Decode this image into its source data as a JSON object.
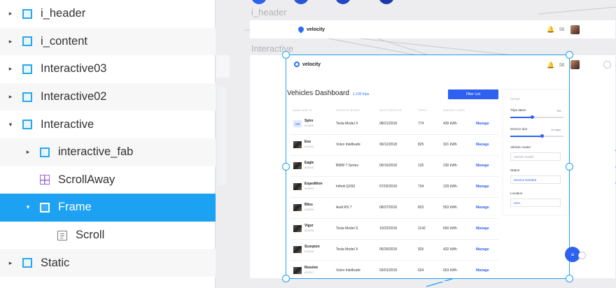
{
  "layers": [
    {
      "label": "i_header",
      "disclosure": "▸",
      "icon": "frame-icon",
      "indent": 0
    },
    {
      "label": "i_content",
      "disclosure": "▸",
      "icon": "frame-icon",
      "indent": 0
    },
    {
      "label": "Interactive03",
      "disclosure": "▸",
      "icon": "frame-icon",
      "indent": 0
    },
    {
      "label": "Interactive02",
      "disclosure": "▸",
      "icon": "frame-icon",
      "indent": 0
    },
    {
      "label": "Interactive",
      "disclosure": "▾",
      "icon": "frame-icon",
      "indent": 0
    },
    {
      "label": "interactive_fab",
      "disclosure": "▸",
      "icon": "frame-icon",
      "indent": 1
    },
    {
      "label": "ScrollAway",
      "disclosure": "",
      "icon": "scrollaway-icon",
      "indent": 1
    },
    {
      "label": "Frame",
      "disclosure": "▾",
      "icon": "frame-icon",
      "indent": 1,
      "selected": true
    },
    {
      "label": "Scroll",
      "disclosure": "",
      "icon": "scroll-icon",
      "indent": 2
    },
    {
      "label": "Static",
      "disclosure": "▸",
      "icon": "frame-icon",
      "indent": 0
    }
  ],
  "canvas": {
    "header_frame_label": "i_header",
    "interactive_frame_label": "Interactive"
  },
  "app": {
    "brand": "velocity",
    "dashboard_title": "Vehicles Dashboard",
    "trip_count": "1,192 trips",
    "filter_button": "Filter List",
    "columns": [
      "NAME AND ID",
      "VEHICLE MODEL",
      "NEXT SERVICE",
      "TRIPS",
      "ENERGY USED"
    ],
    "vehicles": [
      {
        "thumb": "SM",
        "name": "Spire",
        "id": "#12010",
        "model": "Tesla Model X",
        "service": "08/21/2018",
        "trips": "774",
        "energy": "430 kWh",
        "action": "Manage"
      },
      {
        "thumb": "",
        "name": "Eos",
        "id": "#12011",
        "model": "Volvo Intellisafe",
        "service": "06/12/2018",
        "trips": "825",
        "energy": "321 kWh",
        "action": "Manage"
      },
      {
        "thumb": "",
        "name": "Eagle",
        "id": "#12012",
        "model": "BMW 7 Series",
        "service": "06/16/2018",
        "trips": "125",
        "energy": "230 kWh",
        "action": "Manage"
      },
      {
        "thumb": "",
        "name": "Expedition",
        "id": "#12013",
        "model": "Infiniti QX50",
        "service": "07/02/2018",
        "trips": "734",
        "energy": "129 kWh",
        "action": "Manage"
      },
      {
        "thumb": "",
        "name": "Bliss",
        "id": "#12014",
        "model": "Audi RS 7",
        "service": "08/27/2018",
        "trips": "823",
        "energy": "553 kWh",
        "action": "Manage"
      },
      {
        "thumb": "",
        "name": "Vigor",
        "id": "#12015",
        "model": "Tesla Model S",
        "service": "10/22/2018",
        "trips": "1142",
        "energy": "650 kWh",
        "action": "Manage"
      },
      {
        "thumb": "",
        "name": "Scorpion",
        "id": "#12016",
        "model": "Tesla Model X",
        "service": "05/29/2018",
        "trips": "925",
        "energy": "432 kWh",
        "action": "Manage"
      },
      {
        "thumb": "",
        "name": "Resolve",
        "id": "#12017",
        "model": "Volvo Intellisafe",
        "service": "03/01/2018",
        "trips": "624",
        "energy": "653 kWh",
        "action": "Manage"
      }
    ],
    "filters": {
      "heading": "FILTER",
      "trips_label": "Trips taken",
      "trips_value": "750",
      "trips_level": 0.42,
      "service_label": "Service due",
      "service_value": "14 days",
      "service_level": 0.6,
      "model_label": "Vehicle model",
      "model_placeholder": "Vehicle model",
      "status_label": "Status",
      "status_value": "Service Needed",
      "location_label": "Location",
      "location_value": "USA"
    }
  },
  "colors": {
    "selection": "#1da1f2",
    "accent": "#2f61f0",
    "frame_icon": "#29a8e9",
    "scrollaway_icon": "#9a6ad9"
  }
}
